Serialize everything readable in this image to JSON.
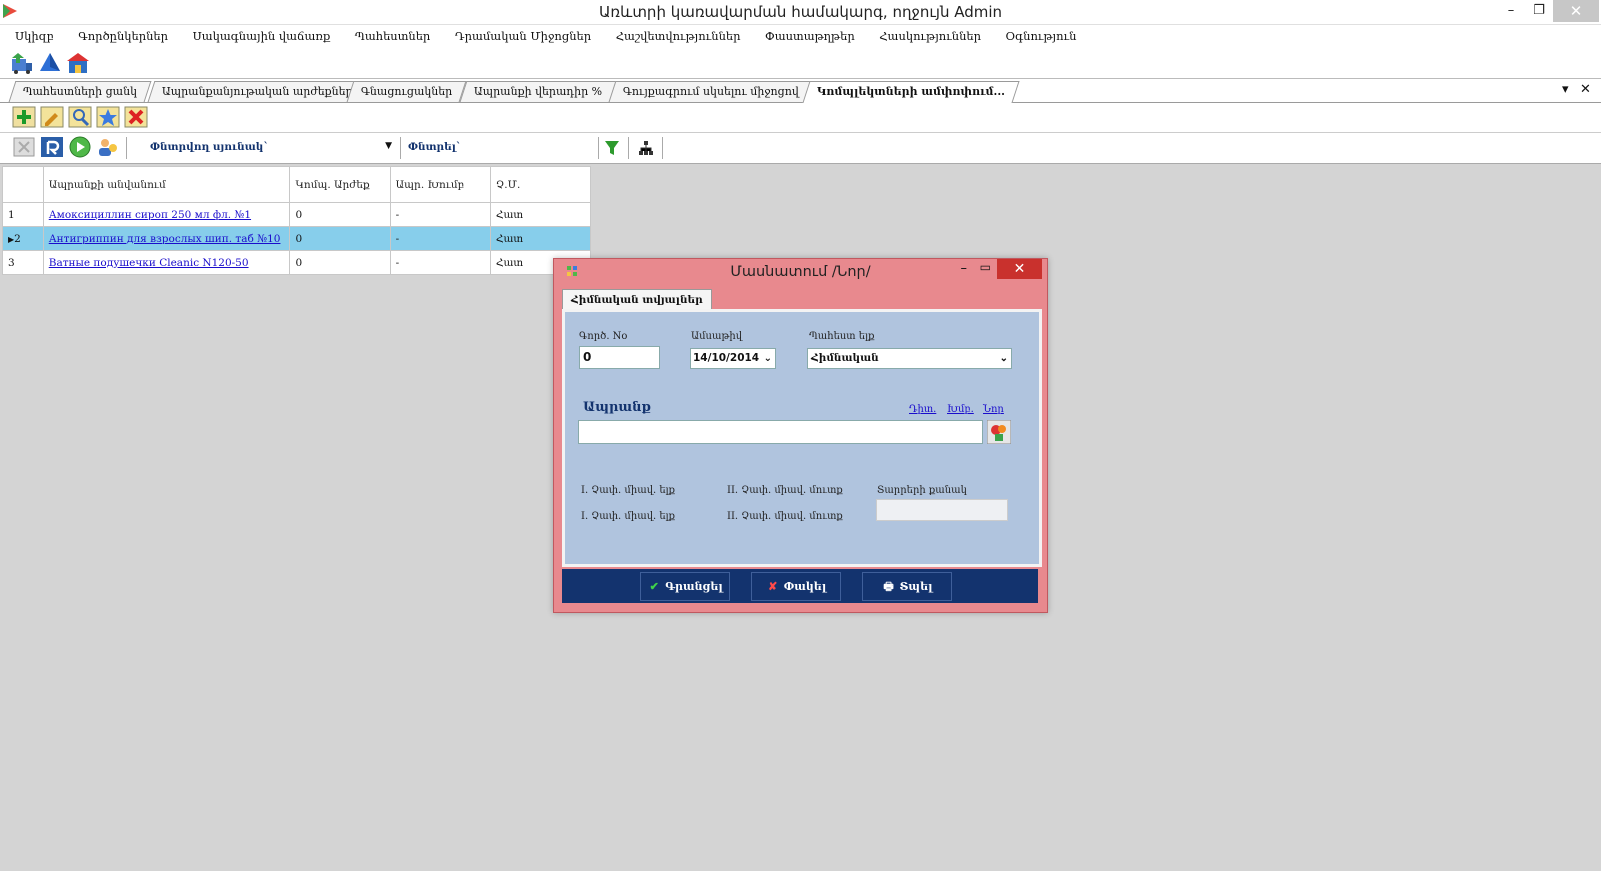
{
  "window": {
    "title": "Առևտրի կառավարման համակարգ, ողջույն Admin"
  },
  "menu": [
    "Սկիզբ",
    "Գործընկերներ",
    "Սակագնային վաճառք",
    "Պահեստներ",
    "Դրամական Միջոցներ",
    "Հաշվետվություններ",
    "Փաստաթղթեր",
    "Հասկություններ",
    "Օգնություն"
  ],
  "tabs": [
    "Պահեստների ցանկ",
    "Ապրանքանյութական արժեքներ...",
    "Գնացուցակներ",
    "Ապրանքի վերադիր %",
    "Գույքագրում սկսելու միջոցով",
    "Կոմպլեկտների ամփոփում..."
  ],
  "search": {
    "column_label": "Փնտրվող սյունակ`",
    "search_label": "Փնտրել`"
  },
  "table": {
    "headers": [
      "",
      "Ապրանքի անվանում",
      "Կոմպ. Արժեք",
      "Ապր. Խումբ",
      "Չ.Մ."
    ],
    "rows": [
      {
        "num": "1",
        "name": "Амоксициллин сироп 250 мл фл. №1",
        "value": "0",
        "group": "-",
        "unit": "Հատ"
      },
      {
        "num": "2",
        "name": "Антигриппин для взрослых шип. таб №10",
        "value": "0",
        "group": "-",
        "unit": "Հատ"
      },
      {
        "num": "3",
        "name": "Ватные подушечки Cleanic N120-50",
        "value": "0",
        "group": "-",
        "unit": "Հատ"
      }
    ]
  },
  "dialog": {
    "title": "Մասնատում /Նոր/",
    "tab": "Հիմնական տվյալներ",
    "doc_no_label": "Գործ. No",
    "doc_no_value": "0",
    "date_label": "Ամսաթիվ",
    "date_value": "14/10/2014",
    "warehouse_label": "Պահեստ ելք",
    "warehouse_value": "Հիմնական",
    "product_label": "Ապրանք",
    "link_view": "Դիտ.",
    "link_edit": "Խմբ.",
    "link_new": "Նոր",
    "unit1_out": "I. Չափ. միավ. ելք",
    "unit1_out2": "I. Չափ. միավ. ելք",
    "unit2_in": "II. Չափ. միավ. մուտք",
    "unit2_in2": "II. Չափ. միավ. մուտք",
    "qty_label": "Տարրերի քանակ",
    "btn_save": "Գրանցել",
    "btn_close": "Փակել",
    "btn_print": "Տպել"
  }
}
